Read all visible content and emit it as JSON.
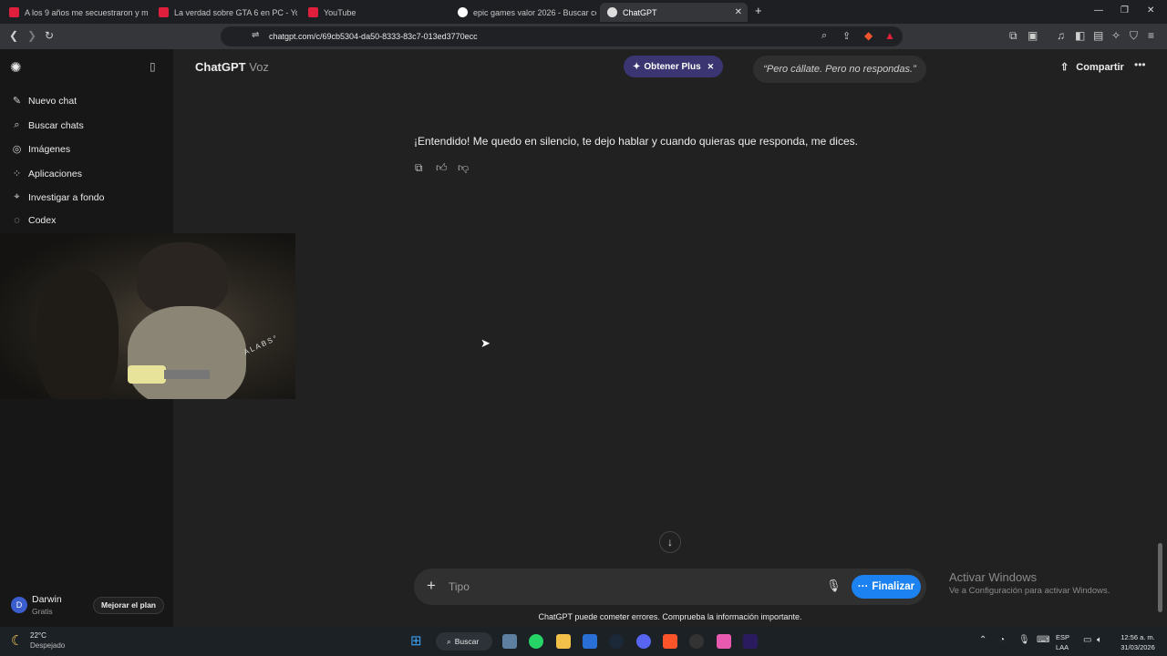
{
  "browser": {
    "tabs": [
      {
        "title": "A los 9 años me secuestraron y me e",
        "color": "#e01f3d"
      },
      {
        "title": "La verdad sobre GTA 6 en PC - YouTu",
        "color": "#e01f3d"
      },
      {
        "title": "YouTube",
        "color": "#e01f3d"
      },
      {
        "title": "epic games valor 2026 - Buscar con G",
        "color": "#dddddd"
      },
      {
        "title": "ChatGPT",
        "color": "#dddddd"
      }
    ],
    "url": "chatgpt.com/c/69cb5304-da50-8333-83c7-013ed3770ecc"
  },
  "sidebar": {
    "items": [
      {
        "label": "Nuevo chat",
        "icon": "edit-icon"
      },
      {
        "label": "Buscar chats",
        "icon": "search-icon"
      },
      {
        "label": "Imágenes",
        "icon": "image-icon"
      },
      {
        "label": "Aplicaciones",
        "icon": "apps-icon"
      },
      {
        "label": "Investigar a fondo",
        "icon": "telescope-icon"
      },
      {
        "label": "Codex",
        "icon": "codex-icon"
      }
    ],
    "user": {
      "initial": "D",
      "name": "Darwin",
      "plan": "Gratis",
      "upgrade": "Mejorar el plan"
    }
  },
  "header": {
    "title": "ChatGPT",
    "mode": "Voz",
    "plus_label": "Obtener Plus",
    "voice_quote": "“Pero cállate. Pero no respondas.”",
    "share_label": "Compartir"
  },
  "chat": {
    "message": "¡Entendido! Me quedo en silencio, te dejo hablar y cuando quieras que responda, me dices."
  },
  "composer": {
    "placeholder": "Tipo",
    "finish_label": "Finalizar",
    "disclaimer": "ChatGPT puede cometer errores. Comprueba la información importante."
  },
  "watermark": {
    "line1": "Activar Windows",
    "line2": "Ve a Configuración para activar Windows."
  },
  "taskbar": {
    "temperature": "22°C",
    "condition": "Despejado",
    "search_label": "Buscar",
    "lang1": "ESP",
    "lang2": "LAA",
    "time": "12:56 a. m.",
    "date": "31/03/2026"
  },
  "webcam": {
    "mic_brand": "ALABS°"
  }
}
